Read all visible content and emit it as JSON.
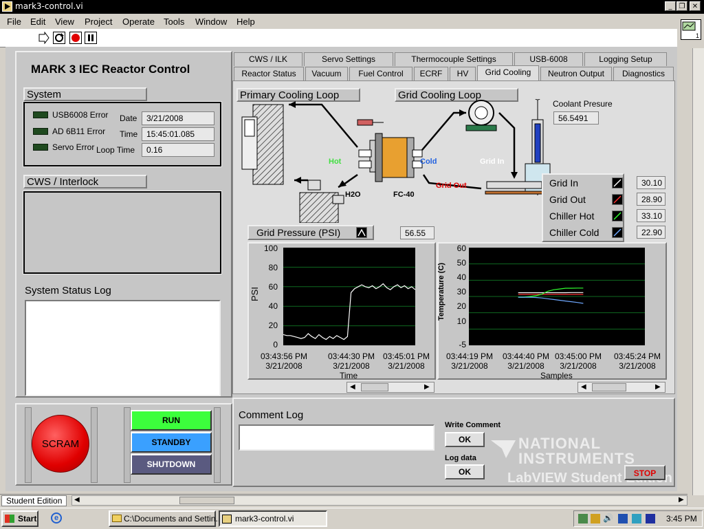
{
  "window": {
    "title": "mark3-control.vi"
  },
  "menu": {
    "items": [
      "File",
      "Edit",
      "View",
      "Project",
      "Operate",
      "Tools",
      "Window",
      "Help"
    ]
  },
  "panel": {
    "title": "MARK 3 IEC Reactor Control",
    "system": {
      "label": "System",
      "errors": [
        "USB6008 Error",
        "AD 6B11 Error",
        "Servo Error"
      ],
      "date_label": "Date",
      "date": "3/21/2008",
      "time_label": "Time",
      "time": "15:45:01.085",
      "loop_label": "Loop Time",
      "loop": "0.16"
    },
    "cws_label": "CWS / Interlock",
    "status_log_label": "System Status Log",
    "scram_label": "SCRAM",
    "run_label": "RUN",
    "standby_label": "STANDBY",
    "shutdown_label": "SHUTDOWN",
    "tabs_row1": [
      "CWS / ILK",
      "Servo Settings",
      "Thermocouple Settings",
      "USB-6008",
      "Logging Setup"
    ],
    "tabs_row2": [
      "Reactor Status",
      "Vacuum",
      "Fuel Control",
      "ECRF",
      "HV",
      "Grid Cooling",
      "Neutron Output",
      "Diagnostics"
    ],
    "diagram": {
      "primary_label": "Primary Cooling Loop",
      "grid_label": "Grid Cooling Loop",
      "coolant_label": "Coolant Presure",
      "coolant_value": "56.5491",
      "hot": "Hot",
      "cold": "Cold",
      "grid_in": "Grid In",
      "grid_out": "Grid Out",
      "h2o": "H2O",
      "fc40": "FC-40"
    },
    "temps": [
      {
        "name": "Grid In",
        "value": "30.10",
        "color": "#ffffff"
      },
      {
        "name": "Grid Out",
        "value": "28.90",
        "color": "#ff3030"
      },
      {
        "name": "Chiller Hot",
        "value": "33.10",
        "color": "#30ff30"
      },
      {
        "name": "Chiller Cold",
        "value": "22.90",
        "color": "#6fa8ff"
      }
    ],
    "pressure_chart": {
      "legend": "Grid Pressure (PSI)",
      "value": "56.55",
      "ylabel": "PSI",
      "xlabel": "Time",
      "yticks": [
        "100",
        "80",
        "60",
        "40",
        "20",
        "0"
      ],
      "xticks": [
        [
          "03:43:56 PM",
          "3/21/2008"
        ],
        [
          "03:44:30 PM",
          "3/21/2008"
        ],
        [
          "03:45:01 PM",
          "3/21/2008"
        ]
      ]
    },
    "temp_chart": {
      "ylabel": "Temperature (C)",
      "xlabel": "Samples",
      "yticks": [
        "60",
        "50",
        "40",
        "30",
        "20",
        "10",
        "-5"
      ],
      "xticks": [
        [
          "03:44:19 PM",
          "3/21/2008"
        ],
        [
          "03:44:40 PM",
          "3/21/2008"
        ],
        [
          "03:45:00 PM",
          "3/21/2008"
        ],
        [
          "03:45:24 PM",
          "3/21/2008"
        ]
      ]
    },
    "comment_log_label": "Comment Log",
    "write_comment_label": "Write Comment",
    "log_data_label": "Log data",
    "ok_label": "OK",
    "stop_label": "STOP",
    "watermark": [
      "NATIONAL",
      "INSTRUMENTS",
      "LabVIEW Student Edition"
    ]
  },
  "chart_data": [
    {
      "type": "line",
      "title": "Grid Pressure (PSI)",
      "xlabel": "Time",
      "ylabel": "PSI",
      "ylim": [
        0,
        100
      ],
      "series": [
        {
          "name": "Grid Pressure (PSI)",
          "color": "#ffffff",
          "values": [
            11,
            10,
            10,
            9,
            8,
            7,
            8,
            12,
            9,
            7,
            11,
            8,
            6,
            9,
            7,
            10,
            8,
            6,
            9,
            54,
            58,
            60,
            62,
            60,
            59,
            61,
            58,
            60,
            63,
            59,
            57,
            60,
            62,
            59,
            61,
            58,
            60,
            57
          ]
        }
      ]
    },
    {
      "type": "line",
      "xlabel": "Samples",
      "ylabel": "Temperature (C)",
      "ylim": [
        -5,
        60
      ],
      "series": [
        {
          "name": "Grid In",
          "color": "#ffffff",
          "values": [
            30,
            30,
            30,
            30,
            30,
            30,
            30,
            30,
            30,
            30.1,
            30.1,
            30.1
          ]
        },
        {
          "name": "Grid Out",
          "color": "#ff3030",
          "values": [
            28.9,
            28.9,
            28.9,
            28.9,
            28.9,
            28.9,
            28.9,
            28.9,
            28.9,
            28.9,
            28.9,
            28.9
          ]
        },
        {
          "name": "Chiller Hot",
          "color": "#30ff30",
          "values": [
            27,
            27,
            27.5,
            28,
            29,
            31,
            32,
            32.5,
            33,
            33,
            33.1,
            33.1
          ]
        },
        {
          "name": "Chiller Cold",
          "color": "#6fa8ff",
          "values": [
            27,
            27,
            27,
            26.8,
            26.5,
            26,
            25.5,
            25,
            24.5,
            24,
            23.5,
            22.9
          ]
        }
      ]
    }
  ],
  "statusbar": {
    "edition": "Student Edition"
  },
  "taskbar": {
    "start": "Start",
    "item1": "C:\\Documents and Settin...",
    "item2": "mark3-control.vi",
    "clock": "3:45 PM"
  }
}
